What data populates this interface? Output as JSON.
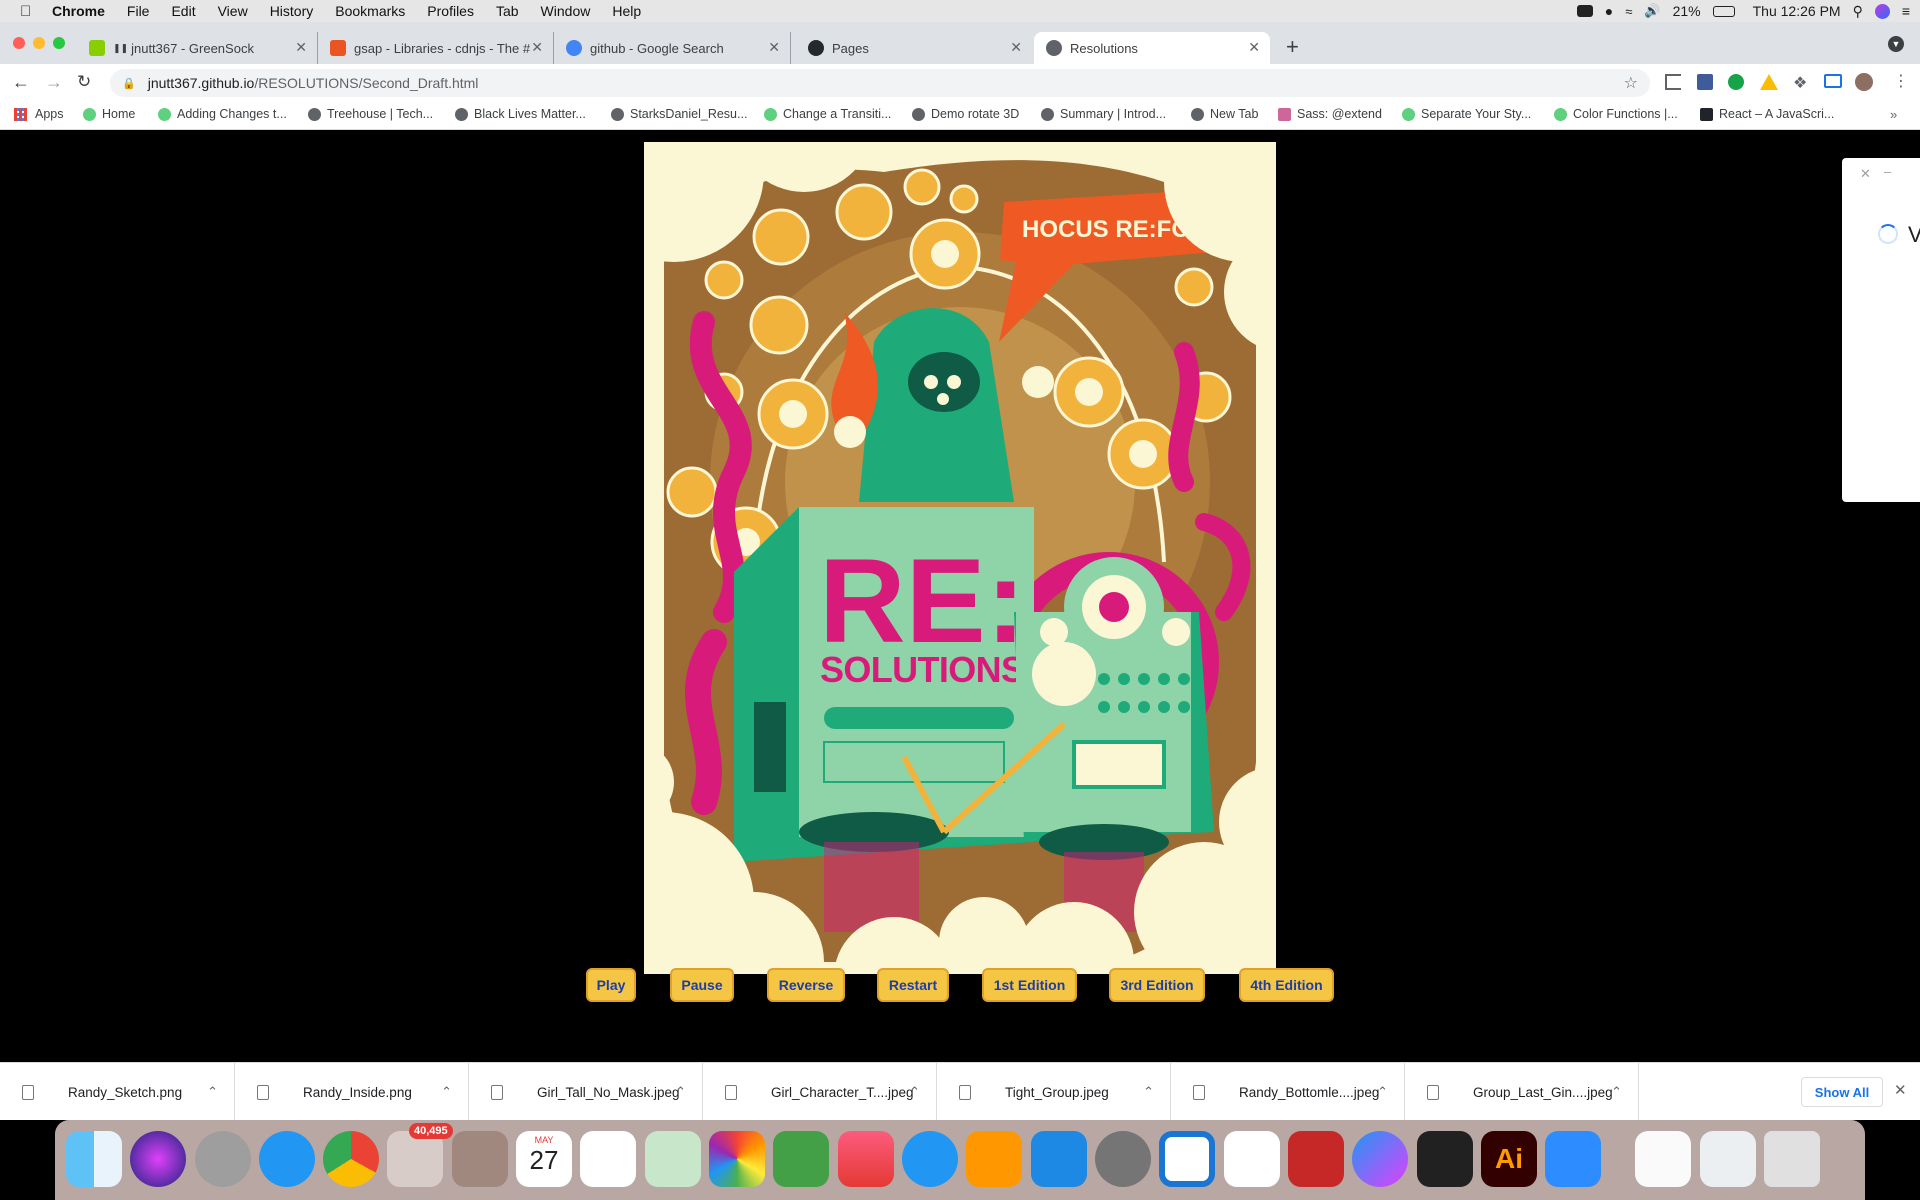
{
  "menubar": {
    "app": "Chrome",
    "items": [
      "File",
      "Edit",
      "View",
      "History",
      "Bookmarks",
      "Profiles",
      "Tab",
      "Window",
      "Help"
    ],
    "battery": "21%",
    "clock": "Thu 12:26 PM"
  },
  "tabs": [
    {
      "title": "jnutt367 - GreenSock",
      "fav_color": "#88ce02"
    },
    {
      "title": "gsap - Libraries - cdnjs - The #",
      "fav_color": "#e95420"
    },
    {
      "title": "github - Google Search",
      "fav_color": "#4285f4"
    },
    {
      "title": "Pages",
      "fav_color": "#24292e"
    },
    {
      "title": "Resolutions",
      "fav_color": "#5f6368"
    }
  ],
  "address": {
    "host": "jnutt367.github.io",
    "path": "/RESOLUTIONS/Second_Draft.html"
  },
  "bookmarks": [
    "Apps",
    "Home",
    "Adding Changes t...",
    "Treehouse | Tech...",
    "Black Lives Matter...",
    "StarksDaniel_Resu...",
    "Change a Transiti...",
    "Demo rotate 3D",
    "Summary | Introd...",
    "New Tab",
    "Sass: @extend",
    "Separate Your Sty...",
    "Color Functions |...",
    "React – A JavaScri..."
  ],
  "poster": {
    "speech": "HOCUS RE:FOCUS!",
    "title_big": "RE:",
    "title_small": "SOLUTIONS"
  },
  "controls": [
    "Play",
    "Pause",
    "Reverse",
    "Restart",
    "1st Edition",
    "3rd Edition",
    "4th Edition"
  ],
  "sidepanel": {
    "letter": "V"
  },
  "downloads": [
    "Randy_Sketch.png",
    "Randy_Inside.png",
    "Girl_Tall_No_Mask.jpeg",
    "Girl_Character_T....jpeg",
    "Tight_Group.jpeg",
    "Randy_Bottomle....jpeg",
    "Group_Last_Gin....jpeg"
  ],
  "show_all": "Show All",
  "dock": {
    "mail_badge": "40,495",
    "calendar_month": "MAY",
    "calendar_day": "27",
    "illustrator": "Ai",
    "apps": [
      "finder-icon",
      "siri-icon",
      "launchpad-icon",
      "safari-icon",
      "chrome-icon",
      "mail-icon",
      "contacts-icon",
      "calendar-icon",
      "reminders-icon",
      "maps-icon",
      "photos-icon",
      "facetime-icon",
      "music-icon",
      "messages-icon",
      "books-icon",
      "app-store-icon",
      "system-preferences-icon",
      "vscode-icon",
      "slack-icon",
      "acrobat-icon",
      "messenger-icon",
      "terminal-icon",
      "illustrator-icon",
      "zoom-icon",
      "document-icon",
      "preview-icon",
      "trash-icon"
    ]
  }
}
